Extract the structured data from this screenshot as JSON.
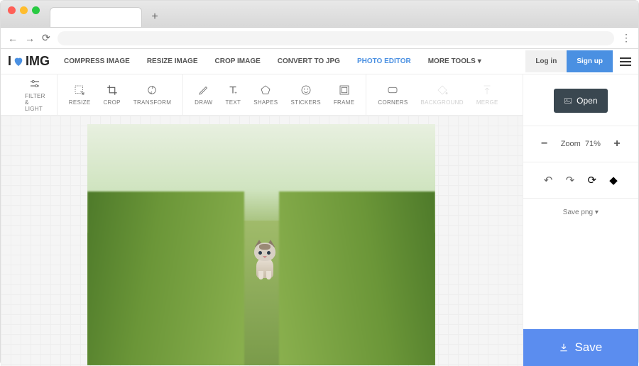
{
  "nav": {
    "compress": "COMPRESS IMAGE",
    "resize": "RESIZE IMAGE",
    "crop": "CROP IMAGE",
    "convert": "CONVERT TO JPG",
    "editor": "PHOTO EDITOR",
    "more": "MORE TOOLS",
    "login": "Log in",
    "signup": "Sign up"
  },
  "logo": {
    "pre": "I",
    "post": "IMG"
  },
  "tools": {
    "filter": "FILTER & LIGHT",
    "resize": "RESIZE",
    "crop": "CROP",
    "transform": "TRANSFORM",
    "draw": "DRAW",
    "text": "TEXT",
    "shapes": "SHAPES",
    "stickers": "STICKERS",
    "frame": "FRAME",
    "corners": "CORNERS",
    "background": "BACKGROUND",
    "merge": "MERGE"
  },
  "panel": {
    "open": "Open",
    "zoom_label": "Zoom",
    "zoom_value": "71%",
    "save_format": "Save png",
    "save": "Save"
  }
}
